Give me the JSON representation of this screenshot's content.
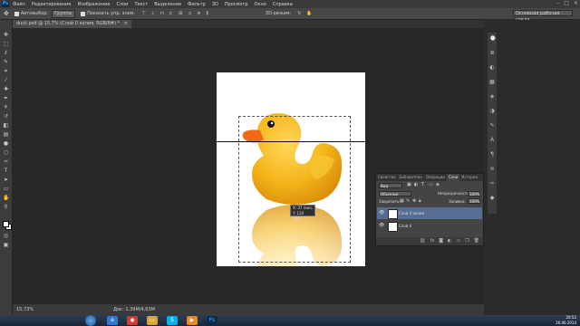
{
  "menubar": {
    "logo": "Ps",
    "items": [
      "Файл",
      "Редактирование",
      "Изображение",
      "Слои",
      "Текст",
      "Выделение",
      "Фильтр",
      "3D",
      "Просмотр",
      "Окно",
      "Справка"
    ]
  },
  "options": {
    "autoselect_label": "Автовыбор:",
    "autoselect_value": "Группа",
    "show_controls_label": "Показать упр. элем.",
    "mode_3d_label": "3D-режим:",
    "workspace": "Основная рабочая среда"
  },
  "document": {
    "tab_title": "duck.psd @ 15,7% (Слой 0 копия, RGB/8#) *"
  },
  "readout": {
    "x": "X: 37 пикс.",
    "y": "Y: 120 пикс."
  },
  "status": {
    "zoom": "15,73%",
    "doc_size": "Док: 1,39M/4,63M"
  },
  "panel": {
    "tabs": [
      "Свойства",
      "Библиотеки",
      "Операции",
      "Слои",
      "История"
    ],
    "active_tab": "Слои",
    "kind_label": "Вид",
    "blend_mode": "Обычные",
    "opacity_label": "Непрозрачность:",
    "opacity_value": "100%",
    "lock_label": "Закрепить:",
    "fill_label": "Заливка:",
    "fill_value": "100%",
    "layers": [
      {
        "name": "Слой 0 копия",
        "selected": true
      },
      {
        "name": "Слой 0",
        "selected": false
      }
    ],
    "bottom_icons": [
      "link-icon",
      "fx-icon",
      "mask-icon",
      "adjustment-icon",
      "folder-icon",
      "new-layer-icon",
      "trash-icon"
    ]
  },
  "taskbar": {
    "time": "20:52",
    "date": "26.06.2014"
  },
  "colors": {
    "menubar": "#3a3a3a",
    "workspace": "#282828",
    "panel": "#444444",
    "selected_layer": "#576e94",
    "duck_yellow": "#f4b41a",
    "beak_orange": "#f06a18"
  }
}
